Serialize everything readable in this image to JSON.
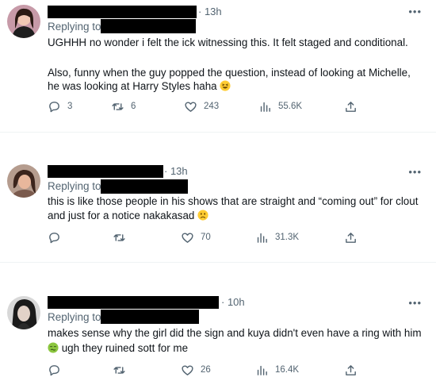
{
  "tweets": [
    {
      "time": "· 13h",
      "more": "•••",
      "replying_label": "Replying to",
      "lines": [
        "UGHHH no wonder i felt the ick witnessing this. It felt staged and conditional.",
        "Also, funny when the guy popped the question, instead of looking at Michelle,",
        "he was looking at Harry Styles haha"
      ],
      "emoji": "grinning-squint-face",
      "stats": {
        "replies": "3",
        "retweets": "6",
        "likes": "243",
        "views": "55.6K"
      }
    },
    {
      "time": "· 13h",
      "more": "•••",
      "replying_label": "Replying to",
      "lines": [
        "this is like those people in his shows that are straight and “coming out” for clout",
        "and just for a notice nakakasad"
      ],
      "emoji": "slightly-frowning-face",
      "stats": {
        "replies": "",
        "retweets": "",
        "likes": "70",
        "views": "31.3K"
      }
    },
    {
      "time": "· 10h",
      "more": "•••",
      "replying_label": "Replying to",
      "lines": [
        "makes sense why the girl did the sign and kuya didn't even have a ring with him",
        "ugh they ruined sott for me"
      ],
      "emoji": "nauseated-face",
      "stats": {
        "replies": "",
        "retweets": "",
        "likes": "26",
        "views": "16.4K"
      }
    }
  ],
  "colors": {
    "text": "#0f1419",
    "muted": "#536471",
    "divider": "#eff3f4",
    "redaction": "#000000"
  }
}
